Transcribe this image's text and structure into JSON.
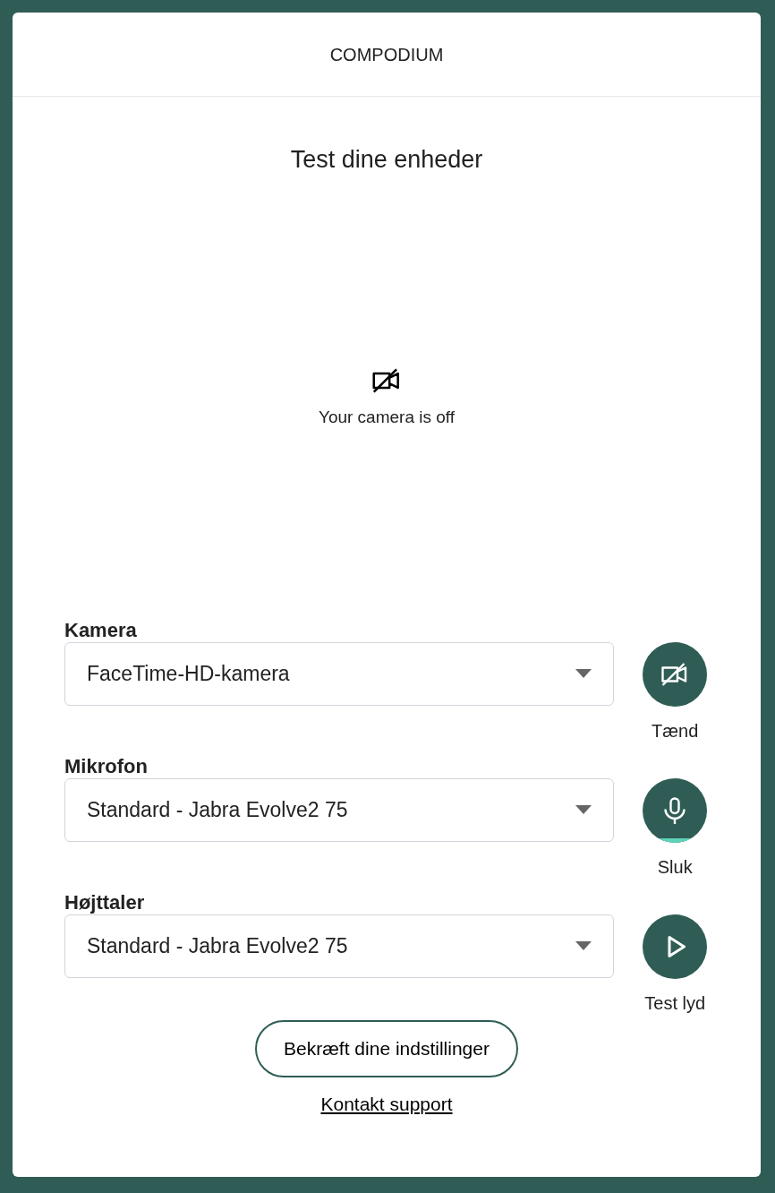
{
  "header": {
    "brand": "COMPODIUM"
  },
  "title": "Test dine enheder",
  "preview": {
    "camera_on": false,
    "message": "Your camera is off"
  },
  "devices": [
    {
      "kind": "camera",
      "label": "Kamera",
      "value": "FaceTime-HD-kamera",
      "button": "Tænd",
      "on": false
    },
    {
      "kind": "microphone",
      "label": "Mikrofon",
      "value": "Standard - Jabra Evolve2 75",
      "button": "Sluk",
      "on": true
    },
    {
      "kind": "speaker",
      "label": "Højttaler",
      "value": "Standard - Jabra Evolve2 75",
      "button": "Test lyd"
    }
  ],
  "confirm_button": "Bekræft dine indstillinger",
  "support_link": "Kontakt support"
}
